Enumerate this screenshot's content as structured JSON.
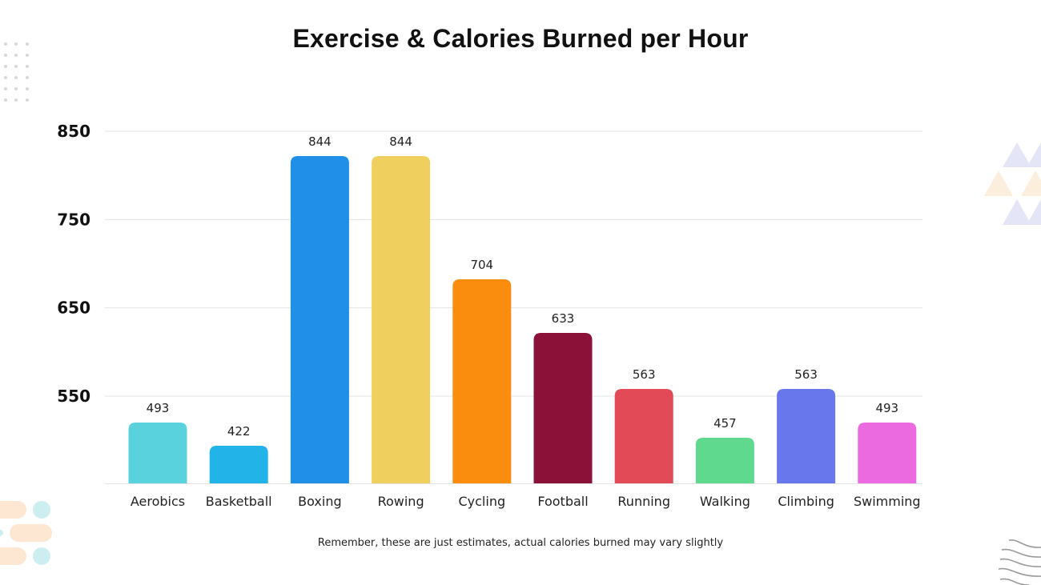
{
  "chart_data": {
    "type": "bar",
    "title": "Exercise & Calories Burned per Hour",
    "xlabel": "",
    "ylabel": "",
    "categories": [
      "Aerobics",
      "Basketball",
      "Boxing",
      "Rowing",
      "Cycling",
      "Football",
      "Running",
      "Walking",
      "Climbing",
      "Swimming"
    ],
    "values": [
      493,
      422,
      844,
      844,
      704,
      633,
      563,
      457,
      563,
      493
    ],
    "colors": [
      "#5ad2de",
      "#22b3e8",
      "#208fe8",
      "#efcf5e",
      "#fa8c0e",
      "#8b1139",
      "#e14a56",
      "#5fd98d",
      "#6878ec",
      "#ec6ae0"
    ],
    "data_labels": [
      "493",
      "422",
      "844",
      "844",
      "704",
      "633",
      "563",
      "457",
      "563",
      "493"
    ],
    "yticks": [
      550,
      650,
      750,
      850
    ],
    "ytick_labels": [
      "550",
      "650",
      "750",
      "850"
    ],
    "grid": true,
    "legend": "none"
  },
  "footnote": "Remember, these are just estimates, actual calories burned may vary slightly"
}
